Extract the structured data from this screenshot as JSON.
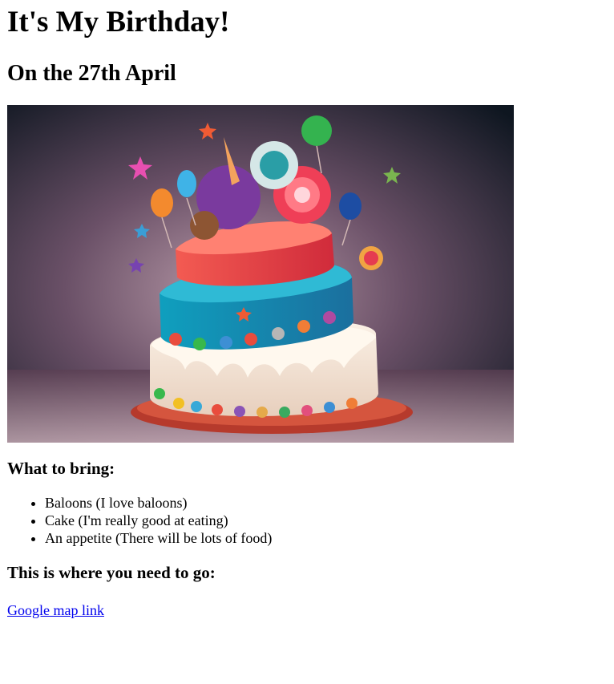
{
  "page": {
    "title": "It's My Birthday!",
    "subtitle": "On the 27th April"
  },
  "image": {
    "subject": "cake-image"
  },
  "bring": {
    "heading": "What to bring:",
    "items": [
      "Baloons (I love baloons)",
      "Cake (I'm really good at eating)",
      "An appetite (There will be lots of food)"
    ]
  },
  "location": {
    "heading": "This is where you need to go:",
    "link_text": "Google map link"
  },
  "colors": {
    "link": "#0000ee",
    "text": "#000000",
    "background": "#ffffff"
  }
}
